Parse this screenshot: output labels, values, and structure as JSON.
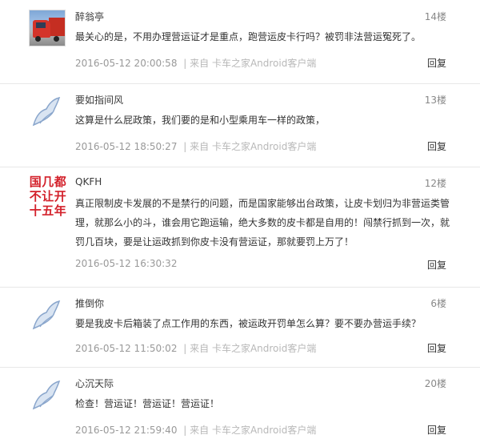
{
  "comments": [
    {
      "username": "醉翁亭",
      "floor": "14楼",
      "content": "最关心的是，不用办理营运证才是重点，跑营运皮卡行吗？被罚非法营运冤死了。",
      "time": "2016-05-12 20:00:58",
      "source": "| 来自 卡车之家Android客户端",
      "reply": "回复",
      "avatar": "truck-photo"
    },
    {
      "username": "要如指间风",
      "floor": "13楼",
      "content": "这算是什么屁政策，我们要的是和小型乘用车一样的政策，",
      "time": "2016-05-12 18:50:27",
      "source": "| 来自 卡车之家Android客户端",
      "reply": "回复",
      "avatar": "default-avatar"
    },
    {
      "username": "QKFH",
      "floor": "12楼",
      "avatar_text": "国几都不让开十五年",
      "avatar_text_lines": [
        "国几都",
        "不让开",
        "十五年"
      ],
      "content": "真正限制皮卡发展的不是禁行的问题，而是国家能够出台政策，让皮卡划归为非营运类管理，就那么小的斗，谁会用它跑运输，绝大多数的皮卡都是自用的！闯禁行抓到一次，就罚几百块，要是让运政抓到你皮卡没有营运证，那就要罚上万了！",
      "time": "2016-05-12 16:30:32",
      "source": "",
      "reply": "回复",
      "avatar": "text-avatar"
    },
    {
      "username": "推倒你",
      "floor": "6楼",
      "content": "要是我皮卡后箱装了点工作用的东西，被运政开罚单怎么算？要不要办营运手续？",
      "time": "2016-05-12 11:50:02",
      "source": "| 来自 卡车之家Android客户端",
      "reply": "回复",
      "avatar": "default-avatar"
    },
    {
      "username": "心沉天际",
      "floor": "20楼",
      "content": "检查！营运证！营运证！营运证！",
      "time": "2016-05-12 21:59:40",
      "source": "| 来自 卡车之家Android客户端",
      "reply": "回复",
      "avatar": "default-avatar"
    }
  ]
}
